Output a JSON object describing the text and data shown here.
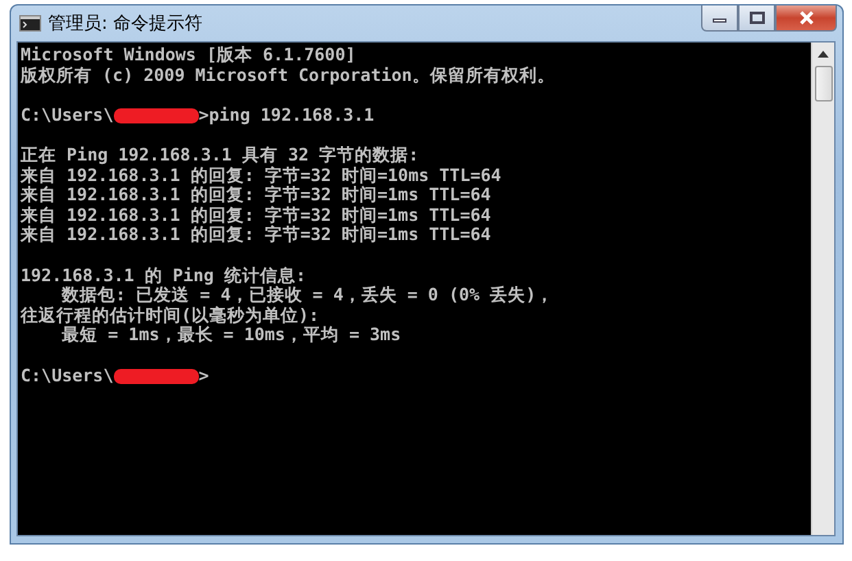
{
  "window": {
    "title": "管理员: 命令提示符"
  },
  "console": {
    "lines": [
      {
        "kind": "text",
        "text": "Microsoft Windows [版本 6.1.7600]"
      },
      {
        "kind": "text",
        "text": "版权所有 (c) 2009 Microsoft Corporation。保留所有权利。"
      },
      {
        "kind": "blank"
      },
      {
        "kind": "prompt",
        "path": "C:\\Users\\",
        "redacted": true,
        "command": ">ping 192.168.3.1"
      },
      {
        "kind": "blank"
      },
      {
        "kind": "text",
        "text": "正在 Ping 192.168.3.1 具有 32 字节的数据:"
      },
      {
        "kind": "text",
        "text": "来自 192.168.3.1 的回复: 字节=32 时间=10ms TTL=64"
      },
      {
        "kind": "text",
        "text": "来自 192.168.3.1 的回复: 字节=32 时间=1ms TTL=64"
      },
      {
        "kind": "text",
        "text": "来自 192.168.3.1 的回复: 字节=32 时间=1ms TTL=64"
      },
      {
        "kind": "text",
        "text": "来自 192.168.3.1 的回复: 字节=32 时间=1ms TTL=64"
      },
      {
        "kind": "blank"
      },
      {
        "kind": "text",
        "text": "192.168.3.1 的 Ping 统计信息:"
      },
      {
        "kind": "text",
        "text": "    数据包: 已发送 = 4，已接收 = 4，丢失 = 0 (0% 丢失)，"
      },
      {
        "kind": "text",
        "text": "往返行程的估计时间(以毫秒为单位):"
      },
      {
        "kind": "text",
        "text": "    最短 = 1ms，最长 = 10ms，平均 = 3ms"
      },
      {
        "kind": "blank"
      },
      {
        "kind": "prompt",
        "path": "C:\\Users\\",
        "redacted": true,
        "command": ">"
      }
    ]
  }
}
